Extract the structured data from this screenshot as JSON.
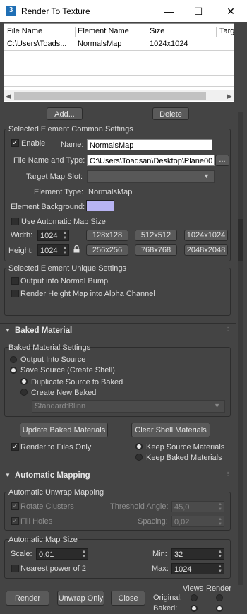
{
  "window": {
    "app_icon_label": "3",
    "title": "Render To Texture",
    "minimize": "—",
    "maximize": "☐",
    "close": "✕"
  },
  "object_list": {
    "columns": [
      "File Name",
      "Element Name",
      "Size",
      "Targ"
    ],
    "rows": [
      {
        "file": "C:\\Users\\Toads...",
        "element": "NormalsMap",
        "size": "1024x1024"
      }
    ]
  },
  "list_buttons": {
    "add": "Add...",
    "delete": "Delete"
  },
  "common": {
    "title": "Selected Element Common Settings",
    "enable_label": "Enable",
    "enable_checked": true,
    "name_label": "Name:",
    "name_value": "NormalsMap",
    "file_label": "File Name and Type:",
    "file_value": "C:\\Users\\Toadsan\\Desktop\\Plane00",
    "browse": "...",
    "target_slot_label": "Target Map Slot:",
    "target_slot_value": "",
    "element_type_label": "Element Type:",
    "element_type_value": "NormalsMap",
    "background_label": "Element Background:",
    "background_color": "#b7b3f2",
    "auto_map_label": "Use Automatic Map Size",
    "auto_map_checked": false,
    "width_label": "Width:",
    "width_value": "1024",
    "height_label": "Height:",
    "height_value": "1024",
    "size_presets": [
      "128x128",
      "512x512",
      "1024x1024",
      "256x256",
      "768x768",
      "2048x2048"
    ]
  },
  "unique": {
    "title": "Selected Element Unique Settings",
    "normal_bump_label": "Output into Normal Bump",
    "height_alpha_label": "Render Height Map into Alpha Channel"
  },
  "baked_material": {
    "rollout_title": "Baked Material",
    "settings_title": "Baked Material Settings",
    "output_into_source": "Output Into Source",
    "save_source": "Save Source (Create Shell)",
    "duplicate_source": "Duplicate Source to Baked",
    "create_new": "Create New Baked",
    "material_type": "Standard:Blinn",
    "update_button": "Update Baked Materials",
    "clear_button": "Clear Shell Materials",
    "render_to_files_label": "Render to Files Only",
    "keep_source": "Keep Source Materials",
    "keep_baked": "Keep Baked Materials"
  },
  "automatic_mapping": {
    "rollout_title": "Automatic Mapping",
    "unwrap_title": "Automatic Unwrap Mapping",
    "rotate_clusters": "Rotate Clusters",
    "fill_holes": "Fill Holes",
    "threshold_label": "Threshold Angle:",
    "threshold_value": "45,0",
    "spacing_label": "Spacing:",
    "spacing_value": "0,02",
    "map_size_title": "Automatic Map Size",
    "scale_label": "Scale:",
    "scale_value": "0,01",
    "min_label": "Min:",
    "min_value": "32",
    "max_label": "Max:",
    "max_value": "1024",
    "nearest_power": "Nearest power of 2"
  },
  "bottom": {
    "render": "Render",
    "unwrap_only": "Unwrap Only",
    "close": "Close",
    "views_label": "Views",
    "render_label": "Render",
    "original_label": "Original:",
    "baked_label": "Baked:"
  }
}
